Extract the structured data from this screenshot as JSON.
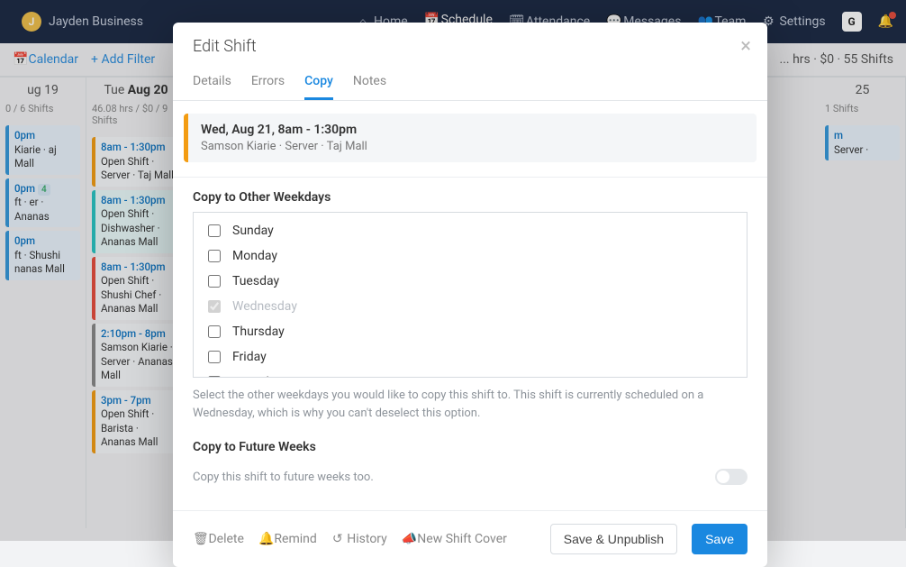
{
  "topbar": {
    "user_initial": "J",
    "user_name": "Jayden Business",
    "nav": {
      "home": "Home",
      "schedule": "Schedule",
      "attendance": "Attendance",
      "messages": "Messages",
      "team": "Team",
      "settings": "Settings"
    },
    "square": "G"
  },
  "subbar": {
    "calendar": "Calendar",
    "add_filter": "+ Add Filter",
    "summary": "... hrs · $0 · 55 Shifts"
  },
  "cols": [
    {
      "head": "ug 19",
      "sub": "0 / 6 Shifts",
      "shifts": [
        {
          "cls": "blueish",
          "t": "0pm",
          "b": "Kiarie · aj Mall"
        },
        {
          "cls": "blueish",
          "t": "0pm",
          "b": "ft · er · Ananas",
          "tag": "4"
        },
        {
          "cls": "blueish",
          "t": "0pm",
          "b": "ft · Shushi nanas Mall"
        }
      ]
    },
    {
      "head": "Tue <b>Aug 20</b>",
      "sub": "46.08 hrs / $0 / 9 Shifts",
      "shifts": [
        {
          "cls": "orange",
          "t": "8am - 1:30pm",
          "b": "Open Shift · Server · Taj Mall"
        },
        {
          "cls": "teal",
          "t": "8am - 1:30pm",
          "b": "Open Shift · Dishwasher · Ananas Mall"
        },
        {
          "cls": "red",
          "t": "8am - 1:30pm",
          "b": "Open Shift · Shushi Chef · Ananas Mall"
        },
        {
          "cls": "",
          "t": "2:10pm - 8pm",
          "b": "Samson Kiarie · Server · Ananas Mall"
        },
        {
          "cls": "orange",
          "t": "3pm - 7pm",
          "b": "Open Shift · Barista · Ananas Mall"
        }
      ]
    },
    {
      "head": "25",
      "sub": "1 Shifts",
      "shifts": [
        {
          "cls": "blueish",
          "t": "m",
          "b": "Server ·"
        }
      ]
    }
  ],
  "modal": {
    "title": "Edit Shift",
    "tabs": {
      "details": "Details",
      "errors": "Errors",
      "copy": "Copy",
      "notes": "Notes"
    },
    "summary_line1": "Wed, Aug 21, 8am - 1:30pm",
    "summary_line2": "Samson Kiarie · Server · Taj Mall",
    "copy_weekdays_head": "Copy to Other Weekdays",
    "days": [
      "Sunday",
      "Monday",
      "Tuesday",
      "Wednesday",
      "Thursday",
      "Friday",
      "Saturday"
    ],
    "disabled_day": "Wednesday",
    "hint": "Select the other weekdays you would like to copy this shift to. This shift is currently scheduled on a Wednesday, which is why you can't deselect this option.",
    "future_head": "Copy to Future Weeks",
    "future_sub": "Copy this shift to future weeks too.",
    "foot": {
      "delete": "Delete",
      "remind": "Remind",
      "history": "History",
      "cover": "New Shift Cover",
      "save_unpub": "Save & Unpublish",
      "save": "Save"
    }
  }
}
